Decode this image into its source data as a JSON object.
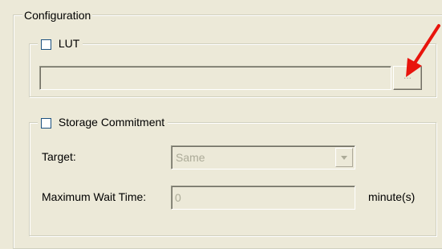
{
  "configuration": {
    "title": "Configuration"
  },
  "lut": {
    "label": "LUT",
    "checked": false,
    "path_value": "",
    "browse_label": "..."
  },
  "storage_commitment": {
    "label": "Storage Commitment",
    "checked": false,
    "target_label": "Target:",
    "target_value": "Same",
    "max_wait_label": "Maximum Wait Time:",
    "max_wait_value": "0",
    "unit_label": "minute(s)"
  },
  "colors": {
    "window_bg": "#ece9d8",
    "disabled_text": "#acab98",
    "annotation_arrow": "#e8140c"
  }
}
